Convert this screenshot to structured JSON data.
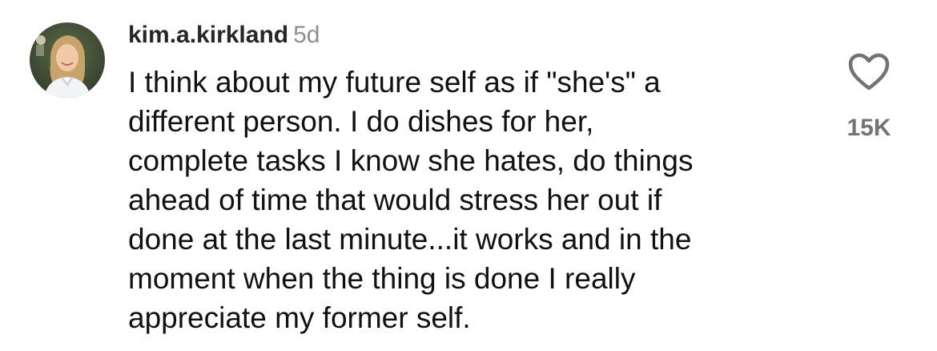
{
  "comment": {
    "username": "kim.a.kirkland",
    "timestamp": "5d",
    "text_lines": [
      "I think about my future self as if \"she's\" a",
      "different person. I do dishes for her,",
      "complete tasks I know she hates, do things",
      "ahead of time that would stress her out if",
      "done at the last minute...it works and in the",
      "moment when the thing is done I really",
      "appreciate my former self."
    ],
    "like_count": "15K",
    "like_icon": "heart-outline-icon",
    "avatar_icon": "user-avatar"
  },
  "colors": {
    "username": "#262626",
    "timestamp": "#8e8e8e",
    "body_text": "#111111",
    "like_count": "#737373",
    "heart_stroke": "#737373",
    "background": "#ffffff"
  }
}
